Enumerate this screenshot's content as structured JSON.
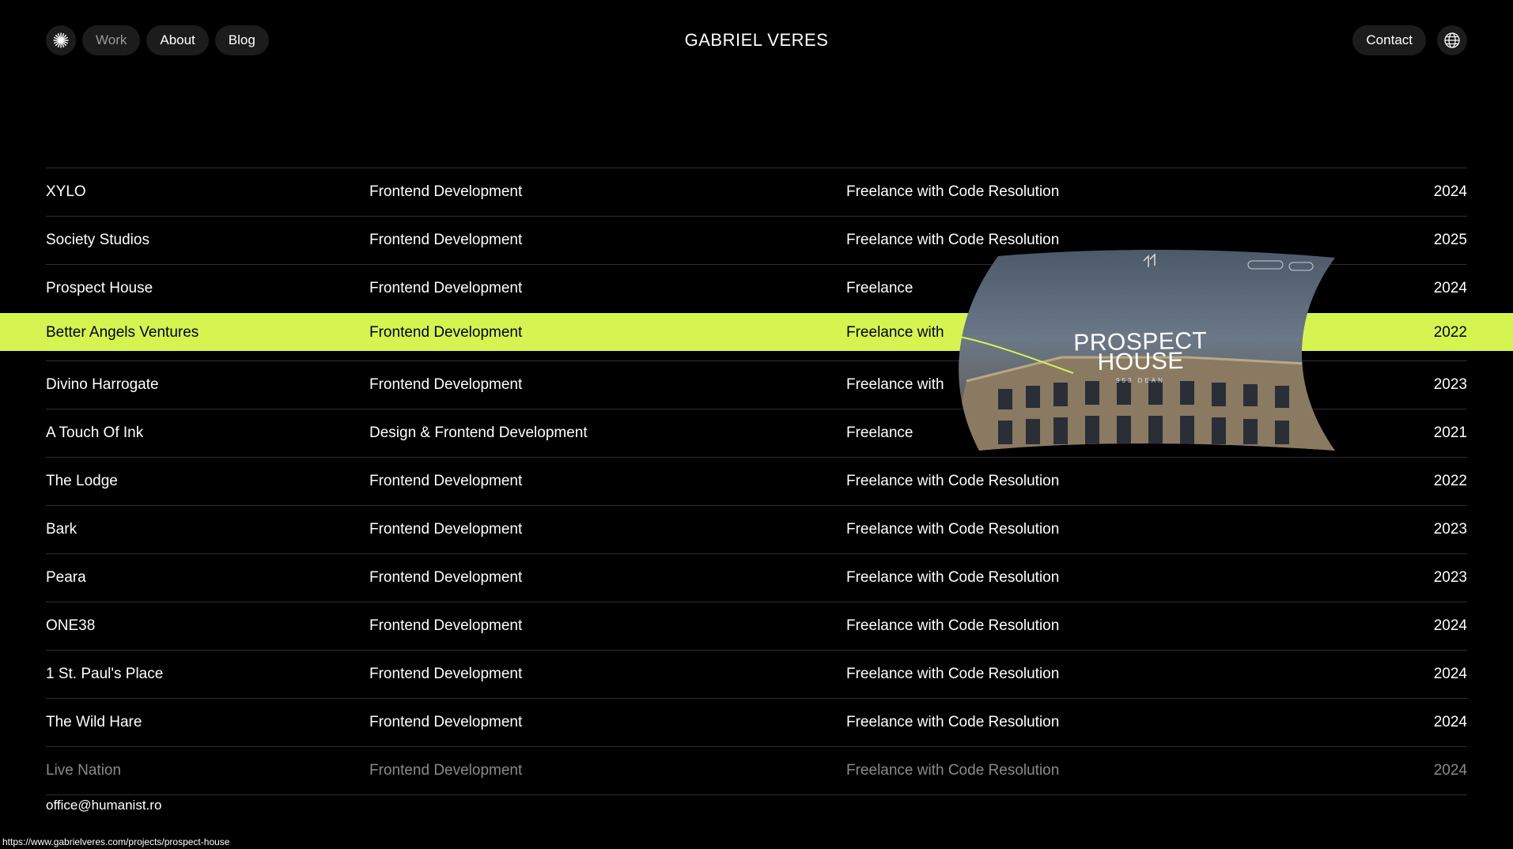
{
  "header": {
    "title": "GABRIEL VERES",
    "nav": [
      {
        "label": "Work"
      },
      {
        "label": "About"
      },
      {
        "label": "Blog"
      }
    ],
    "contact_label": "Contact",
    "logo_icon": "sun-burst-icon",
    "language_icon": "globe-icon"
  },
  "projects": [
    {
      "name": "XYLO",
      "service": "Frontend Development",
      "engagement": "Freelance with Code Resolution",
      "year": "2024"
    },
    {
      "name": "Society Studios",
      "service": "Frontend Development",
      "engagement": "Freelance with Code Resolution",
      "year": "2025"
    },
    {
      "name": "Prospect House",
      "service": "Frontend Development",
      "engagement": "Freelance",
      "year": "2024"
    },
    {
      "name": "Better Angels Ventures",
      "service": "Frontend Development",
      "engagement": "Freelance with",
      "year": "2022"
    },
    {
      "name": "Divino Harrogate",
      "service": "Frontend Development",
      "engagement": "Freelance with",
      "year": "2023"
    },
    {
      "name": "A Touch Of Ink",
      "service": "Design & Frontend Development",
      "engagement": "Freelance",
      "year": "2021"
    },
    {
      "name": "The Lodge",
      "service": "Frontend Development",
      "engagement": "Freelance with Code Resolution",
      "year": "2022"
    },
    {
      "name": "Bark",
      "service": "Frontend Development",
      "engagement": "Freelance with Code Resolution",
      "year": "2023"
    },
    {
      "name": "Peara",
      "service": "Frontend Development",
      "engagement": "Freelance with Code Resolution",
      "year": "2023"
    },
    {
      "name": "ONE38",
      "service": "Frontend Development",
      "engagement": "Freelance with Code Resolution",
      "year": "2024"
    },
    {
      "name": "1 St. Paul's Place",
      "service": "Frontend Development",
      "engagement": "Freelance with Code Resolution",
      "year": "2024"
    },
    {
      "name": "The Wild Hare",
      "service": "Frontend Development",
      "engagement": "Freelance with Code Resolution",
      "year": "2024"
    },
    {
      "name": "Live Nation",
      "service": "Frontend Development",
      "engagement": "Freelance with Code Resolution",
      "year": "2024"
    }
  ],
  "preview": {
    "title_line1": "PROSPECT",
    "title_line2": "HOUSE",
    "subtitle": "953 DEAN"
  },
  "colors": {
    "accent": "#d6f450",
    "background": "#000000"
  },
  "footer": {
    "email": "office@humanist.ro",
    "status_url": "https://www.gabrielveres.com/projects/prospect-house"
  }
}
